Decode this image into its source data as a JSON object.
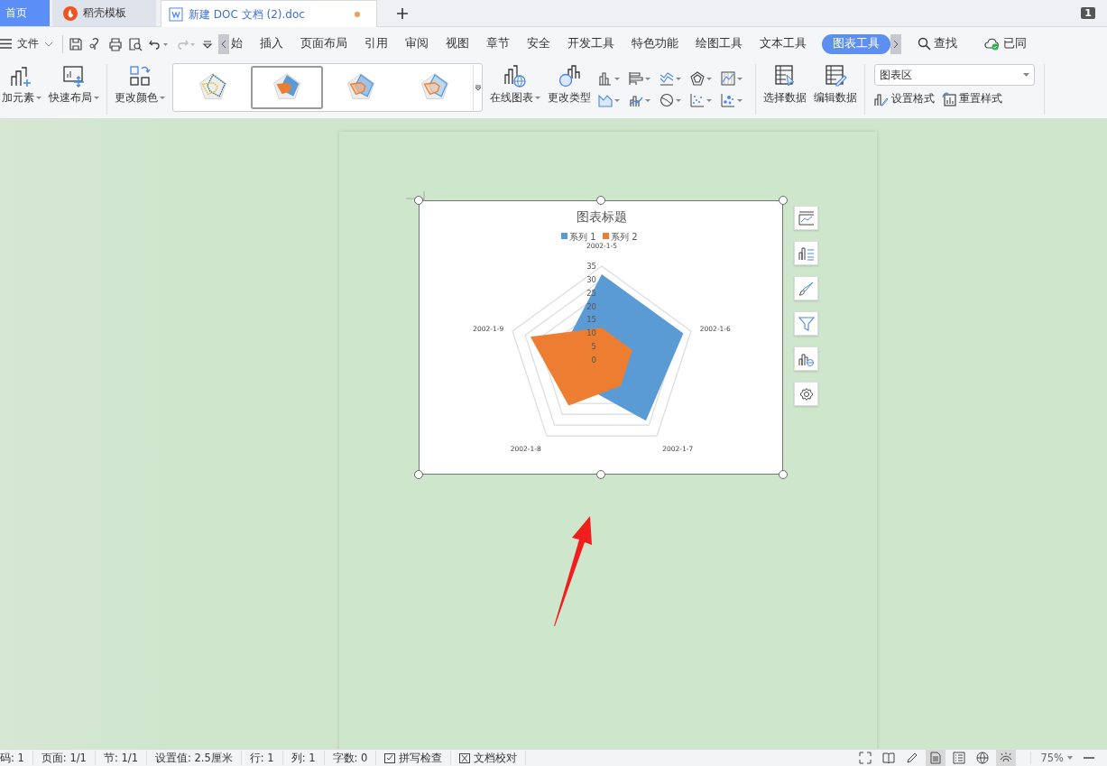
{
  "tabs": [
    {
      "label": "首页",
      "kind": "home",
      "selected": false
    },
    {
      "label": "稻壳模板",
      "kind": "template",
      "selected": false
    },
    {
      "label": "新建 DOC 文档 (2).doc",
      "kind": "doc",
      "selected": true,
      "modified": true
    }
  ],
  "window_count": "1",
  "menu": {
    "file": "文件",
    "items": [
      {
        "label": "始",
        "selected": false
      },
      {
        "label": "插入",
        "selected": false
      },
      {
        "label": "页面布局",
        "selected": false
      },
      {
        "label": "引用",
        "selected": false
      },
      {
        "label": "审阅",
        "selected": false
      },
      {
        "label": "视图",
        "selected": false
      },
      {
        "label": "章节",
        "selected": false
      },
      {
        "label": "安全",
        "selected": false
      },
      {
        "label": "开发工具",
        "selected": false
      },
      {
        "label": "特色功能",
        "selected": false
      },
      {
        "label": "绘图工具",
        "selected": false
      },
      {
        "label": "文本工具",
        "selected": false
      },
      {
        "label": "图表工具",
        "selected": true
      }
    ],
    "search": "查找",
    "sync": "已同"
  },
  "ribbon": {
    "add_element": "加元素",
    "quick_layout": "快速布局",
    "change_color": "更改颜色",
    "styles": [
      {
        "kind": "outline",
        "selected": false
      },
      {
        "kind": "filled",
        "selected": true
      },
      {
        "kind": "light",
        "selected": false
      },
      {
        "kind": "soft",
        "selected": false
      }
    ],
    "online_chart": "在线图表",
    "change_type": "更改类型",
    "select_data": "选择数据",
    "edit_data": "编辑数据",
    "element_select": "图表区",
    "format": "设置格式",
    "reset_style": "重置样式"
  },
  "chart": {
    "title": "图表标题",
    "categories": [
      "2002-1-5",
      "2002-1-6",
      "2002-1-7",
      "2002-1-8",
      "2002-1-9"
    ],
    "series": [
      {
        "name": "系列 1",
        "color": "#5b9bd5"
      },
      {
        "name": "系列 2",
        "color": "#ed7d31"
      }
    ],
    "axis_labels": [
      "35",
      "30",
      "25",
      "20",
      "15",
      "10",
      "5",
      "0"
    ]
  },
  "status_bar": {
    "items": [
      {
        "label": "码: 1",
        "kind": "text"
      },
      {
        "label": "页面: 1/1",
        "kind": "text"
      },
      {
        "label": "节: 1/1",
        "kind": "text"
      },
      {
        "label": "设置值: 2.5厘米",
        "kind": "text"
      },
      {
        "label": "行: 1",
        "kind": "text"
      },
      {
        "label": "列: 1",
        "kind": "text"
      },
      {
        "label": "字数: 0",
        "kind": "text"
      },
      {
        "label": "拼写检查",
        "kind": "check"
      },
      {
        "label": "文档校对",
        "kind": "proof"
      }
    ],
    "views": [
      {
        "kind": "fullscreen",
        "selected": false
      },
      {
        "kind": "read",
        "selected": false
      },
      {
        "kind": "edit",
        "selected": false
      },
      {
        "kind": "page",
        "selected": true
      },
      {
        "kind": "outline",
        "selected": false
      },
      {
        "kind": "web",
        "selected": false
      },
      {
        "kind": "eye",
        "selected": true
      }
    ],
    "zoom": "75%"
  }
}
